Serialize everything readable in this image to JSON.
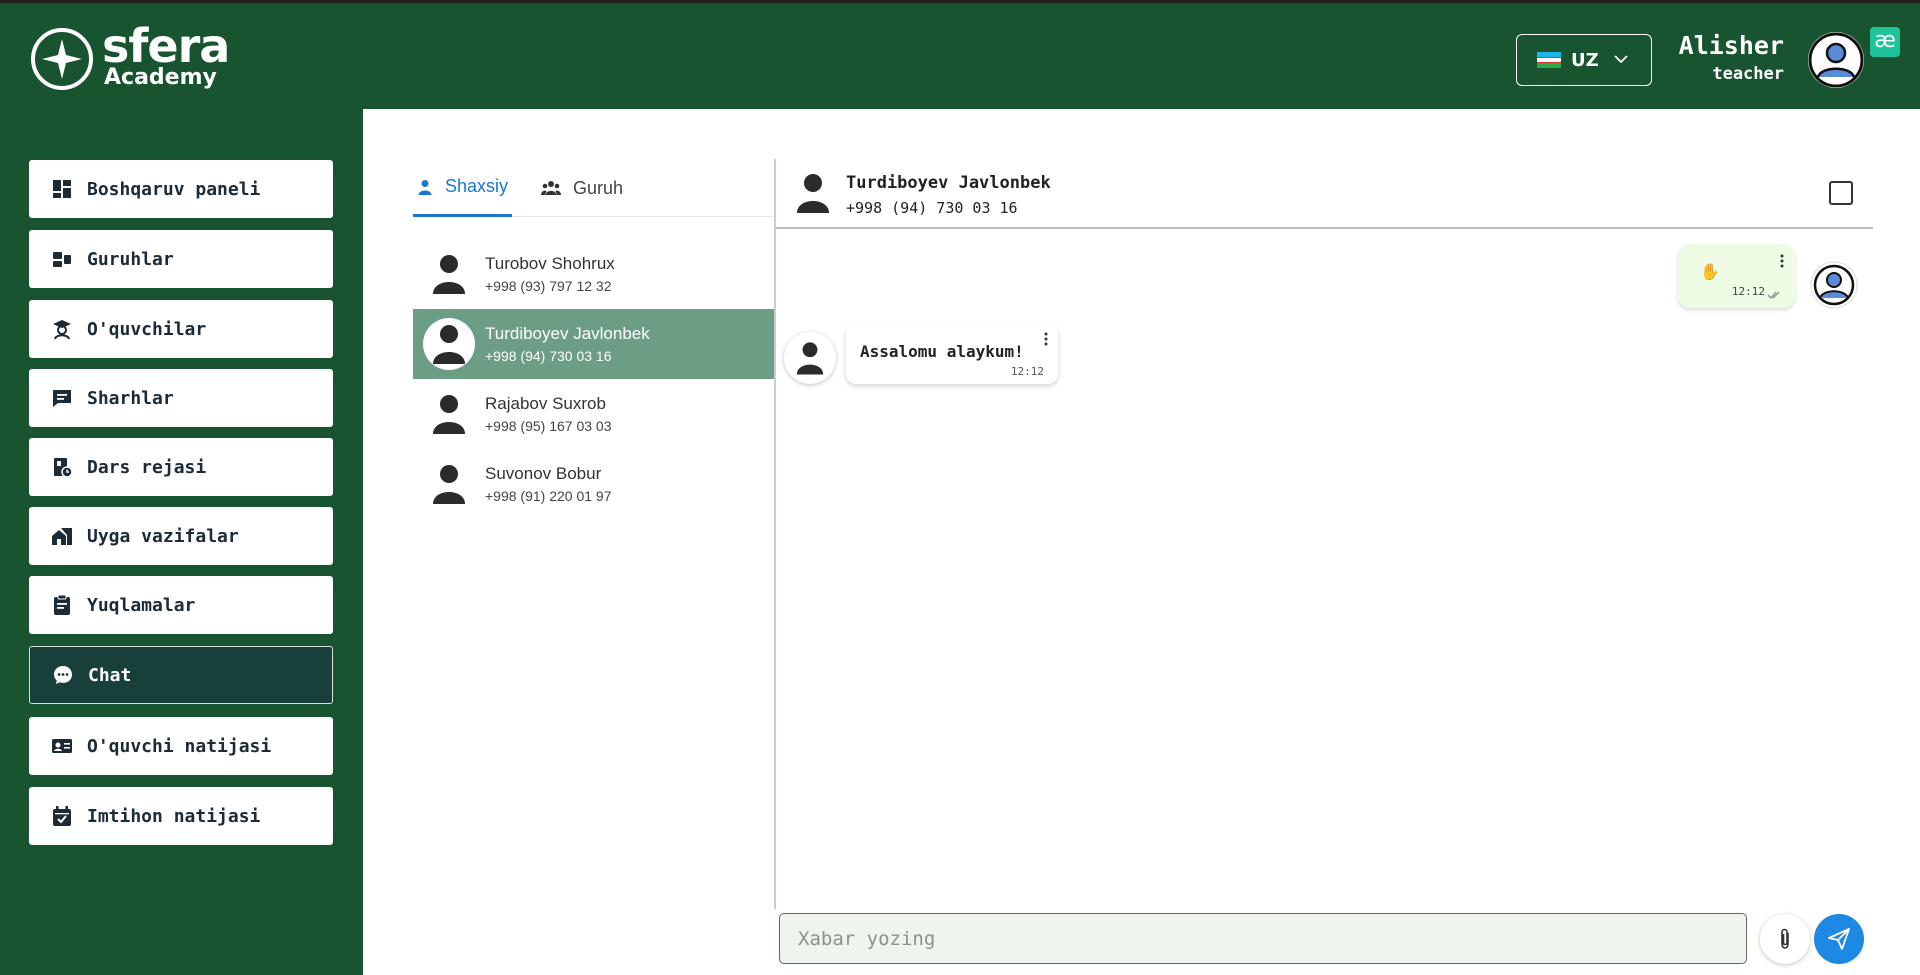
{
  "header": {
    "brand": "sfera",
    "brand_sub": "Academy",
    "language": {
      "code": "UZ"
    },
    "user": {
      "name": "Alisher",
      "role": "teacher"
    },
    "badge": "æ"
  },
  "sidebar": {
    "items": [
      {
        "label": "Boshqaruv paneli",
        "icon": "dashboard-icon",
        "active": false
      },
      {
        "label": "Guruhlar",
        "icon": "groups-icon",
        "active": false
      },
      {
        "label": "O'quvchilar",
        "icon": "student-icon",
        "active": false
      },
      {
        "label": "Sharhlar",
        "icon": "comment-icon",
        "active": false
      },
      {
        "label": "Dars rejasi",
        "icon": "lesson-plan-icon",
        "active": false
      },
      {
        "label": "Uyga vazifalar",
        "icon": "homework-icon",
        "active": false
      },
      {
        "label": "Yuqlamalar",
        "icon": "attendance-icon",
        "active": false
      },
      {
        "label": "Chat",
        "icon": "chat-icon",
        "active": true
      },
      {
        "label": "O'quvchi natijasi",
        "icon": "student-result-icon",
        "active": false
      },
      {
        "label": "Imtihon natijasi",
        "icon": "exam-result-icon",
        "active": false
      }
    ]
  },
  "tabs": [
    {
      "label": "Shaxsiy",
      "icon": "person-icon",
      "active": true
    },
    {
      "label": "Guruh",
      "icon": "group-icon",
      "active": false
    }
  ],
  "contacts": [
    {
      "name": "Turobov Shohrux",
      "phone": "+998 (93) 797 12 32",
      "active": false
    },
    {
      "name": "Turdiboyev Javlonbek",
      "phone": "+998 (94) 730 03 16",
      "active": true
    },
    {
      "name": "Rajabov Suxrob",
      "phone": "+998 (95) 167 03 03",
      "active": false
    },
    {
      "name": "Suvonov Bobur",
      "phone": "+998 (91) 220 01 97",
      "active": false
    }
  ],
  "chat": {
    "contact_name": "Turdiboyev Javlonbek",
    "contact_phone": "+998 (94) 730 03 16",
    "messages": [
      {
        "direction": "out",
        "text": "✋",
        "time": "12:12"
      },
      {
        "direction": "in",
        "text": "Assalomu alaykum!",
        "time": "12:12"
      }
    ],
    "input_placeholder": "Xabar yozing"
  },
  "colors": {
    "brand_green": "#17542f",
    "active_nav": "#183f3a",
    "active_contact": "#6b9e84",
    "accent_blue": "#1976d2",
    "send_blue": "#1e88e5",
    "out_bubble": "#eefbe5"
  }
}
